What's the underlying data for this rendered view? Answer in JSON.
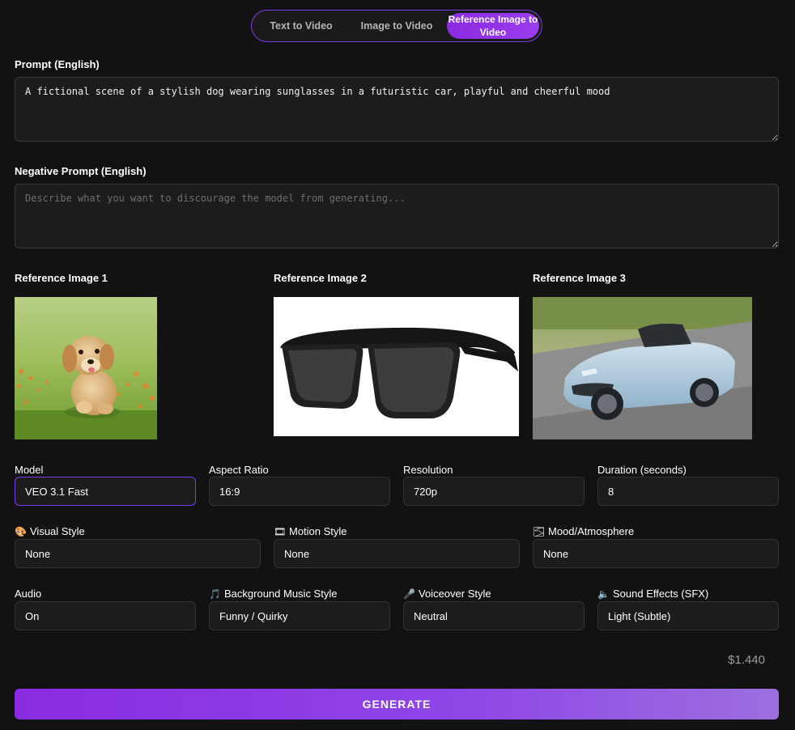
{
  "tabs": [
    {
      "label": "Text to Video"
    },
    {
      "label": "Image to Video"
    },
    {
      "label": "Reference Image to Video"
    }
  ],
  "prompt": {
    "label": "Prompt (English)",
    "value": "A fictional scene of a stylish dog wearing sunglasses in a futuristic car, playful and cheerful mood"
  },
  "negative_prompt": {
    "label": "Negative Prompt (English)",
    "placeholder": "Describe what you want to discourage the model from generating..."
  },
  "references": [
    {
      "label": "Reference Image 1"
    },
    {
      "label": "Reference Image 2"
    },
    {
      "label": "Reference Image 3"
    }
  ],
  "fields": {
    "model": {
      "label": "Model",
      "value": "VEO 3.1 Fast"
    },
    "aspect_ratio": {
      "label": "Aspect Ratio",
      "value": "16:9"
    },
    "resolution": {
      "label": "Resolution",
      "value": "720p"
    },
    "duration": {
      "label": "Duration (seconds)",
      "value": "8"
    },
    "visual_style": {
      "label": "Visual Style",
      "icon": "🎨",
      "value": "None"
    },
    "motion_style": {
      "label": "Motion Style",
      "icon": "🎞",
      "value": "None"
    },
    "mood": {
      "label": "Mood/Atmosphere",
      "icon": "🌫",
      "value": "None"
    },
    "audio": {
      "label": "Audio",
      "value": "On"
    },
    "music": {
      "label": "Background Music Style",
      "icon": "🎵",
      "value": "Funny / Quirky"
    },
    "voiceover": {
      "label": "Voiceover Style",
      "icon": "🎤",
      "value": "Neutral"
    },
    "sfx": {
      "label": "Sound Effects (SFX)",
      "icon": "🔈",
      "value": "Light (Subtle)"
    }
  },
  "price": "$1.440",
  "generate_label": "GENERATE"
}
